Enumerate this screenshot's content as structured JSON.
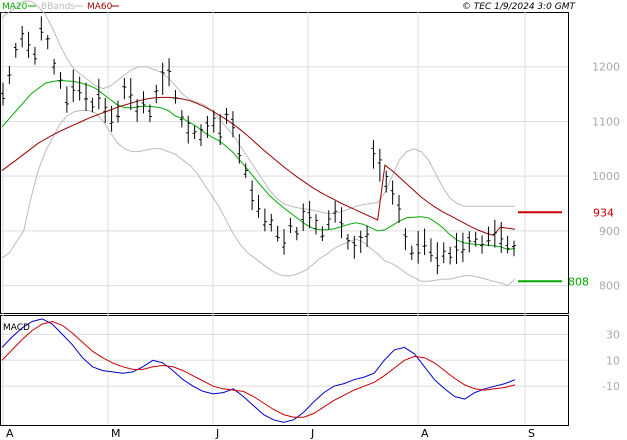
{
  "header": {
    "copyright": "© TEC 1/9/2024 3:0 GMT",
    "legend": [
      {
        "label": "MA20",
        "color": "#00aa00"
      },
      {
        "label": "BBands",
        "color": "#bbbbbb"
      },
      {
        "label": "MA60",
        "color": "#990000"
      }
    ]
  },
  "colors": {
    "resistance": "#cc0000",
    "support": "#00aa00",
    "price": "#000000",
    "macd": "#0000cc",
    "signal": "#cc0000",
    "grid": "#dddddd"
  },
  "chart_data": [
    {
      "type": "line",
      "subtype": "ohlc",
      "x_ticks": [
        "A",
        "M",
        "J",
        "J",
        "A",
        "S"
      ],
      "y_ticks": [
        "800",
        "900",
        "1000",
        "1100",
        "1200"
      ],
      "ylim": [
        750,
        1300
      ],
      "levels": {
        "resistance": {
          "label": "934",
          "value": 934
        },
        "support": {
          "label": "808",
          "value": 808
        }
      },
      "series": [
        {
          "name": "MA20",
          "values": [
            1090,
            1105,
            1120,
            1135,
            1150,
            1160,
            1170,
            1173,
            1175,
            1174,
            1173,
            1170,
            1166,
            1160,
            1150,
            1140,
            1130,
            1125,
            1125,
            1127,
            1128,
            1127,
            1125,
            1120,
            1110,
            1105,
            1098,
            1090,
            1080,
            1072,
            1065,
            1055,
            1043,
            1028,
            1012,
            996,
            980,
            965,
            953,
            942,
            932,
            922,
            912,
            905,
            902,
            902,
            904,
            908,
            912,
            915,
            912,
            906,
            900,
            902,
            910,
            918,
            924,
            925,
            926,
            924,
            916,
            906,
            893,
            883,
            878,
            876,
            875,
            874,
            873,
            871,
            866,
            868
          ]
        },
        {
          "name": "BBands",
          "values": [
            1290,
            1300,
            1310,
            1320,
            1320,
            1310,
            1295,
            1270,
            1240,
            1215,
            1195,
            1185,
            1175,
            1165,
            1160,
            1165,
            1175,
            1185,
            1195,
            1200,
            1200,
            1195,
            1190,
            1180,
            1165,
            1150,
            1140,
            1135,
            1130,
            1120,
            1105,
            1090,
            1075,
            1055,
            1035,
            1015,
            995,
            975,
            960,
            950,
            945,
            942,
            940,
            938,
            935,
            932,
            932,
            935,
            940,
            945,
            948,
            950,
            952,
            970,
            1000,
            1030,
            1045,
            1050,
            1045,
            1030,
            1005,
            980,
            960,
            950,
            945,
            945,
            945,
            945,
            945,
            945,
            945,
            945
          ]
        },
        {
          "name": "BBands",
          "values": [
            850,
            860,
            880,
            900,
            960,
            1010,
            1045,
            1070,
            1095,
            1110,
            1118,
            1120,
            1120,
            1115,
            1100,
            1080,
            1060,
            1050,
            1045,
            1045,
            1048,
            1050,
            1050,
            1045,
            1040,
            1030,
            1020,
            1005,
            985,
            965,
            945,
            920,
            895,
            875,
            860,
            850,
            840,
            830,
            822,
            818,
            818,
            822,
            828,
            838,
            850,
            858,
            868,
            875,
            880,
            885,
            880,
            868,
            858,
            845,
            840,
            832,
            822,
            815,
            808,
            808,
            810,
            812,
            812,
            815,
            818,
            818,
            815,
            812,
            808,
            805,
            800,
            812
          ]
        },
        {
          "name": "MA60",
          "values": [
            1010,
            1020,
            1030,
            1040,
            1050,
            1060,
            1068,
            1075,
            1082,
            1088,
            1094,
            1100,
            1106,
            1111,
            1116,
            1121,
            1126,
            1130,
            1134,
            1138,
            1141,
            1143,
            1144,
            1144,
            1143,
            1141,
            1138,
            1133,
            1127,
            1120,
            1112,
            1104,
            1095,
            1085,
            1074,
            1062,
            1050,
            1039,
            1028,
            1017,
            1007,
            997,
            988,
            979,
            971,
            964,
            957,
            950,
            944,
            938,
            932,
            926,
            920,
            1020,
            1010,
            998,
            986,
            974,
            962,
            952,
            943,
            935,
            928,
            921,
            914,
            907,
            901,
            896,
            892,
            907,
            905,
            903
          ]
        }
      ],
      "price": [
        1150,
        1185,
        1230,
        1255,
        1240,
        1220,
        1270,
        1245,
        1200,
        1175,
        1140,
        1165,
        1160,
        1145,
        1130,
        1150,
        1120,
        1105,
        1118,
        1160,
        1150,
        1120,
        1135,
        1115,
        1150,
        1178,
        1190,
        1145,
        1105,
        1085,
        1080,
        1075,
        1090,
        1100,
        1085,
        1110,
        1095,
        1050,
        1010,
        965,
        945,
        920,
        915,
        895,
        880,
        910,
        895,
        925,
        930,
        912,
        895,
        920,
        935,
        915,
        880,
        870,
        880,
        890,
        1040,
        1020,
        990,
        970,
        940,
        885,
        860,
        870,
        880,
        865,
        850,
        860,
        855,
        868,
        870,
        880,
        885,
        875,
        890,
        895,
        888,
        875,
        868
      ]
    },
    {
      "type": "line",
      "title": "MACD",
      "y_ticks": [
        "30",
        "10",
        "-10"
      ],
      "ylim": [
        -40,
        45
      ],
      "series": [
        {
          "name": "MACD",
          "values": [
            20,
            28,
            35,
            40,
            42,
            38,
            30,
            22,
            12,
            5,
            2,
            1,
            0,
            1,
            5,
            10,
            8,
            2,
            -5,
            -10,
            -14,
            -16,
            -15,
            -12,
            -18,
            -25,
            -32,
            -36,
            -38,
            -36,
            -30,
            -22,
            -15,
            -10,
            -8,
            -5,
            -3,
            0,
            10,
            18,
            20,
            15,
            5,
            -5,
            -12,
            -18,
            -20,
            -15,
            -12,
            -10,
            -8,
            -5
          ]
        },
        {
          "name": "Signal",
          "values": [
            10,
            18,
            26,
            33,
            38,
            40,
            37,
            31,
            24,
            17,
            12,
            8,
            5,
            3,
            3,
            5,
            6,
            5,
            2,
            -2,
            -6,
            -10,
            -12,
            -13,
            -14,
            -18,
            -23,
            -28,
            -32,
            -34,
            -34,
            -31,
            -26,
            -21,
            -17,
            -13,
            -10,
            -7,
            -2,
            4,
            10,
            13,
            12,
            8,
            2,
            -4,
            -9,
            -12,
            -13,
            -12,
            -11,
            -9
          ]
        }
      ]
    }
  ]
}
